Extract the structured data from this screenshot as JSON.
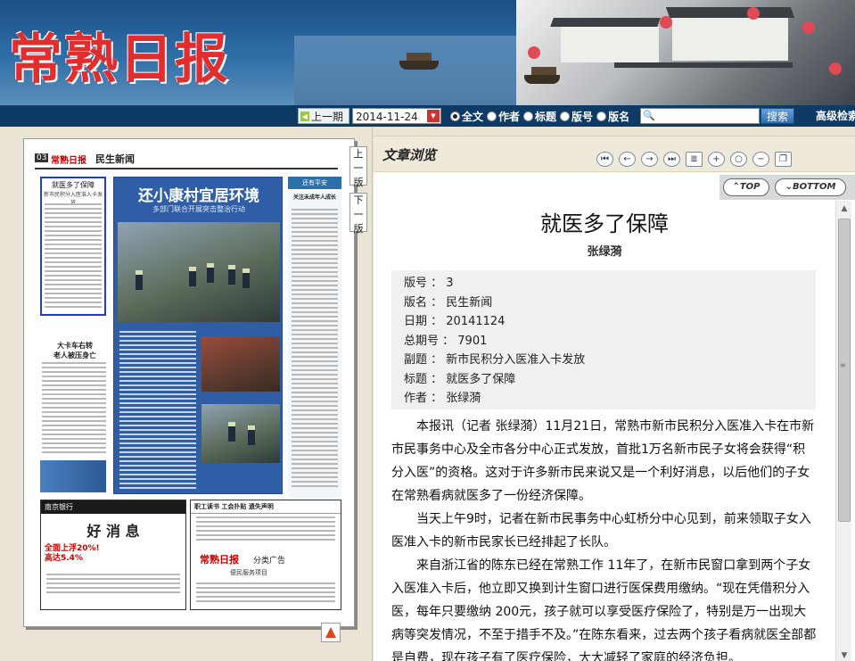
{
  "header": {
    "logo_text": "常熟日报"
  },
  "searchbar": {
    "prev_issue": "上一期",
    "date_value": "2014-11-24",
    "radio_options": [
      "全文",
      "作者",
      "标题",
      "版号",
      "版名"
    ],
    "selected_option": "全文",
    "search_placeholder": "",
    "search_button": "搜索",
    "advanced": "高级检索"
  },
  "page_thumbnail": {
    "page_number": "03",
    "paper_name": "常熟日报",
    "section": "民生新闻",
    "highlight_title": "就医多了保障",
    "highlight_subtitle": "新市民积分入医准入卡发放",
    "feature_title": "还小康村宜居环境",
    "feature_subtitle": "多部门联合开展突击整治行动",
    "mid_title": "大卡车右转\n老人被压身亡",
    "side_column_title": "还有平安",
    "side_column_head": "关注未成年人成长",
    "bank_header": "南京银行",
    "bank_title": "好 消 息",
    "bank_line1": "全面上浮20%!",
    "bank_line2": "高达5.4%",
    "notice_header": "职工读书  工会扑贴      遗失声明",
    "notice_logo": "常熟日报",
    "notice_category": "分类广告",
    "notice_desc": "便民服务项目",
    "prev_page": "上一版",
    "next_page": "下一版"
  },
  "article_panel": {
    "title": "文章浏览",
    "top_button": "TOP",
    "bottom_button": "BOTTOM",
    "tools": [
      "first-page-icon",
      "prev-icon",
      "next-icon",
      "last-page-icon",
      "list-icon",
      "zoom-in-icon",
      "search-zoom-icon",
      "zoom-out-icon",
      "copy-icon"
    ]
  },
  "article": {
    "title": "就医多了保障",
    "author": "张绿漪",
    "meta": [
      {
        "label": "版号",
        "value": "3"
      },
      {
        "label": "版名",
        "value": "民生新闻"
      },
      {
        "label": "日期",
        "value": "20141124"
      },
      {
        "label": "总期号",
        "value": "7901"
      },
      {
        "label": "副题",
        "value": "新市民积分入医准入卡发放"
      },
      {
        "label": "标题",
        "value": "就医多了保障"
      },
      {
        "label": "作者",
        "value": "张绿漪"
      }
    ],
    "paragraphs": [
      "本报讯（记者 张绿漪）11月21日，常熟市新市民积分入医准入卡在市新市民事务中心及全市各分中心正式发放，首批1万名新市民子女将会获得“积分入医”的资格。这对于许多新市民来说又是一个利好消息，以后他们的子女在常熟看病就医多了一份经济保障。",
      "当天上午9时，记者在新市民事务中心虹桥分中心见到，前来领取子女入医准入卡的新市民家长已经排起了长队。",
      "来自浙江省的陈东已经在常熟工作 11年了，在新市民窗口拿到两个子女入医准入卡后，他立即又换到计生窗口进行医保费用缴纳。“现在凭借积分入医，每年只要缴纳 200元，孩子就可以享受医疗保险了，特别是万一出现大病等突发情况，不至于措手不及。”在陈东看来，过去两个孩子看病就医全部都是自费，现在孩子有了医疗保险，大大减轻了家庭的经济负担。"
    ]
  }
}
